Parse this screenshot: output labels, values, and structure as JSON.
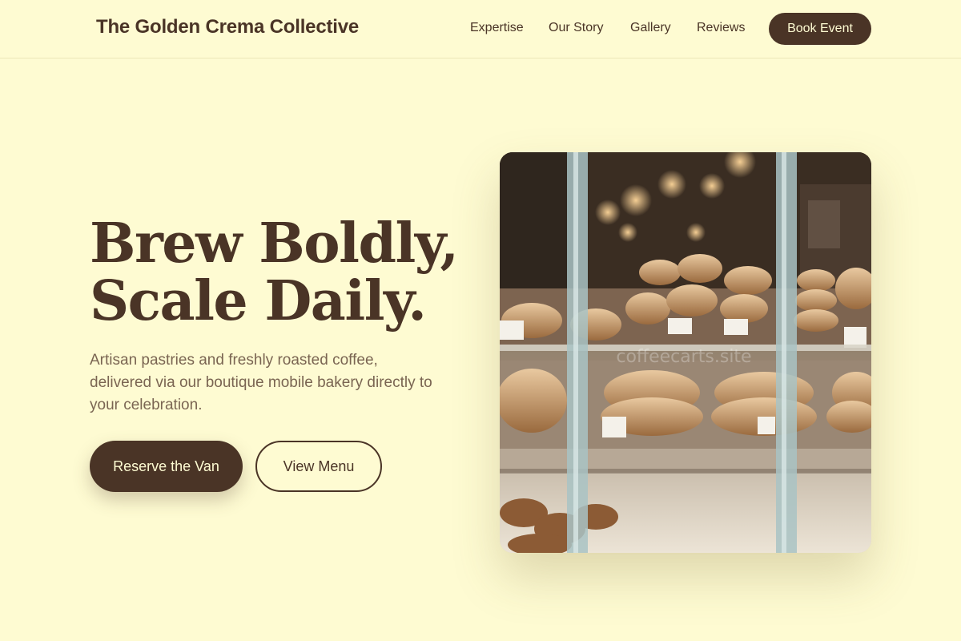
{
  "header": {
    "brand": "The Golden Crema Collective",
    "nav": [
      "Expertise",
      "Our Story",
      "Gallery",
      "Reviews"
    ],
    "cta": "Book Event"
  },
  "hero": {
    "headline_line1": "Brew Boldly,",
    "headline_line2": "Scale Daily.",
    "subtext": "Artisan pastries and freshly roasted coffee, delivered via our boutique mobile bakery directly to your celebration.",
    "primary_button": "Reserve the Van",
    "secondary_button": "View Menu",
    "image_watermark": "coffeecarts.site"
  },
  "colors": {
    "background": "#fefbd2",
    "primary": "#4a3426",
    "muted_text": "#7a6552"
  }
}
